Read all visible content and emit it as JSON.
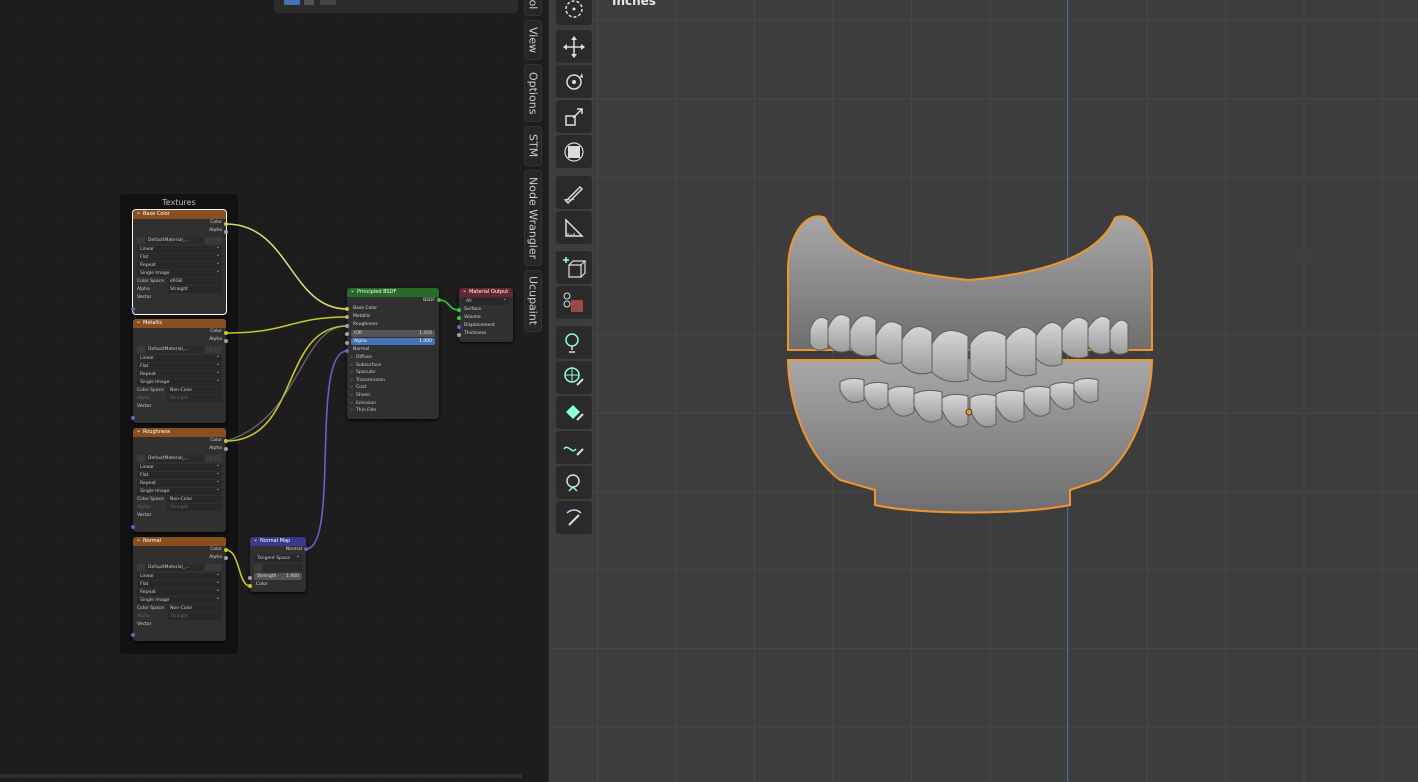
{
  "viewport": {
    "title": "Inches"
  },
  "sidebar_tabs": [
    {
      "label": "Tool"
    },
    {
      "label": "View"
    },
    {
      "label": "Options"
    },
    {
      "label": "STM"
    },
    {
      "label": "Node Wrangler"
    },
    {
      "label": "Ucupaint"
    }
  ],
  "toolbar": {
    "icons": [
      "cursor-icon",
      "move-icon",
      "rotate-icon",
      "scale-icon",
      "transform-icon",
      "annotate-icon",
      "measure-icon",
      "add-cube-icon",
      "extrude-icon",
      "paint-brush-icon",
      "paint-globe-icon",
      "paint-fill-icon",
      "paint-smear-icon",
      "paint-clone-icon",
      "paint-mask-icon"
    ]
  },
  "node_editor": {
    "frame_label": "Textures",
    "texture_nodes": [
      {
        "title": "Base Color",
        "out1": "Color",
        "out2": "Alpha",
        "image": "DefaultMaterial_...",
        "interp": "Linear",
        "proj": "Flat",
        "ext": "Repeat",
        "source": "Single Image",
        "cs_label": "Color Space",
        "cs": "sRGB",
        "alpha_label": "Alpha",
        "alpha": "Straight",
        "vector": "Vector"
      },
      {
        "title": "Metallic",
        "out1": "Color",
        "out2": "Alpha",
        "image": "DefaultMaterial_...",
        "interp": "Linear",
        "proj": "Flat",
        "ext": "Repeat",
        "source": "Single Image",
        "cs_label": "Color Space",
        "cs": "Non-Color",
        "alpha_label": "Alpha",
        "alpha": "Straight",
        "vector": "Vector"
      },
      {
        "title": "Roughness",
        "out1": "Color",
        "out2": "Alpha",
        "image": "DefaultMaterial_...",
        "interp": "Linear",
        "proj": "Flat",
        "ext": "Repeat",
        "source": "Single Image",
        "cs_label": "Color Space",
        "cs": "Non-Color",
        "alpha_label": "Alpha",
        "alpha": "Straight",
        "vector": "Vector"
      },
      {
        "title": "Normal",
        "out1": "Color",
        "out2": "Alpha",
        "image": "DefaultMaterial_...",
        "interp": "Linear",
        "proj": "Flat",
        "ext": "Repeat",
        "source": "Single Image",
        "cs_label": "Color Space",
        "cs": "Non-Color",
        "alpha_label": "Alpha",
        "alpha": "Straight",
        "vector": "Vector"
      }
    ],
    "bsdf": {
      "title": "Principled BSDF",
      "out": "BSDF",
      "inputs": [
        "Base Color",
        "Metallic",
        "Roughness"
      ],
      "ior_label": "IOR",
      "ior": "1.450",
      "alpha_label": "Alpha",
      "alpha": "1.000",
      "normal": "Normal",
      "panels": [
        "Diffuse",
        "Subsurface",
        "Specular",
        "Transmission",
        "Coat",
        "Sheen",
        "Emission",
        "Thin Film"
      ]
    },
    "output": {
      "title": "Material Output",
      "target": "All",
      "inputs": [
        "Surface",
        "Volume",
        "Displacement",
        "Thickness"
      ]
    },
    "normal_map": {
      "title": "Normal Map",
      "out": "Normal",
      "space": "Tangent Space",
      "strength_label": "Strength",
      "strength": "1.000",
      "color": "Color"
    }
  },
  "colors": {
    "outline": "#f0952c",
    "wire_yellow": "#c7c729",
    "wire_gray": "#a1a1a1",
    "wire_purple": "#6363c7"
  }
}
